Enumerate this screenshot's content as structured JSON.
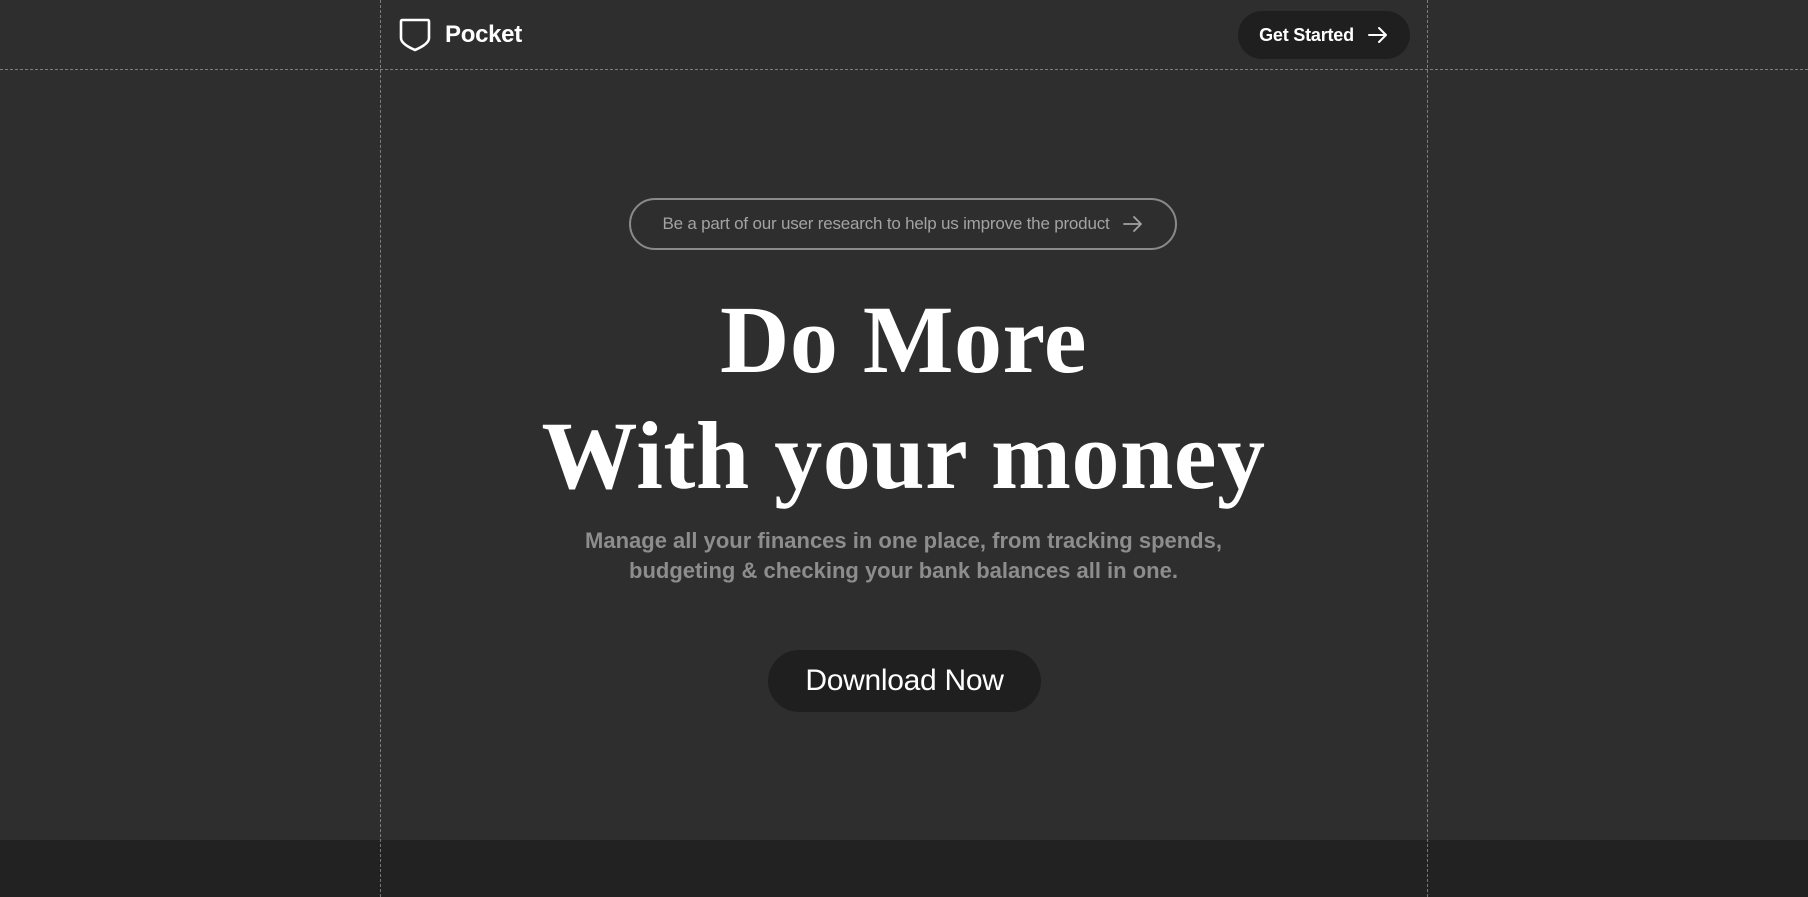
{
  "header": {
    "logo_text": "Pocket",
    "logo_icon": "shield-icon",
    "get_started_label": "Get Started",
    "get_started_icon": "arrow-right-icon"
  },
  "announcement": {
    "text": "Be a part of our user research to help us improve the product",
    "icon": "arrow-right-icon"
  },
  "hero": {
    "title_line_1": "Do More",
    "title_line_2": "With your money",
    "subtitle_line_1": "Manage all your finances in one place, from tracking spends,",
    "subtitle_line_2": "budgeting & checking your bank balances all in one.",
    "cta_label": "Download Now"
  },
  "colors": {
    "background": "#2e2e2e",
    "bottom_band": "#222222",
    "button_bg": "#1f1f1f",
    "heading": "#ffffff",
    "muted_text": "#8d8d8d",
    "pill_border": "#8a8a8a"
  }
}
